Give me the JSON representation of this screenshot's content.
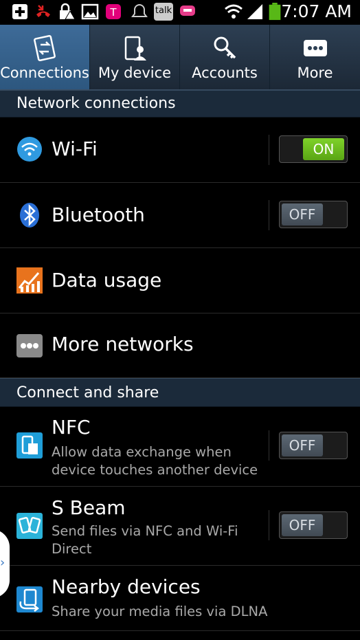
{
  "status_bar": {
    "time": "7:07 AM",
    "icons": [
      "add-icon",
      "missed-call-icon",
      "lock-alert-icon",
      "image-icon",
      "tmobile-icon",
      "bell-icon",
      "talk-icon",
      "chat-icon",
      "wifi-icon",
      "signal-icon",
      "battery-icon"
    ],
    "talk_label": "talk"
  },
  "tabs": [
    {
      "label": "Connections",
      "icon": "connections-icon",
      "active": true
    },
    {
      "label": "My device",
      "icon": "my-device-icon"
    },
    {
      "label": "Accounts",
      "icon": "accounts-key-icon"
    },
    {
      "label": "More",
      "icon": "more-dots-icon"
    }
  ],
  "sections": {
    "network": "Network connections",
    "share": "Connect and share"
  },
  "rows": {
    "wifi": {
      "title": "Wi-Fi",
      "toggle": "ON"
    },
    "bluetooth": {
      "title": "Bluetooth",
      "toggle": "OFF"
    },
    "data_usage": {
      "title": "Data usage"
    },
    "more_networks": {
      "title": "More networks"
    },
    "nfc": {
      "title": "NFC",
      "subtitle_1": "Allow data exchange when",
      "subtitle_2": "device touches another device",
      "toggle": "OFF"
    },
    "sbeam": {
      "title": "S Beam",
      "subtitle_1": "Send files via NFC and Wi-Fi",
      "subtitle_2": "Direct",
      "toggle": "OFF"
    },
    "nearby": {
      "title": "Nearby devices",
      "subtitle_1": "Share your media files via DLNA"
    }
  },
  "colors": {
    "toggle_on": "#5aa515",
    "tab_active": "#3e6b98",
    "section_bg": "#1b2a3a"
  }
}
